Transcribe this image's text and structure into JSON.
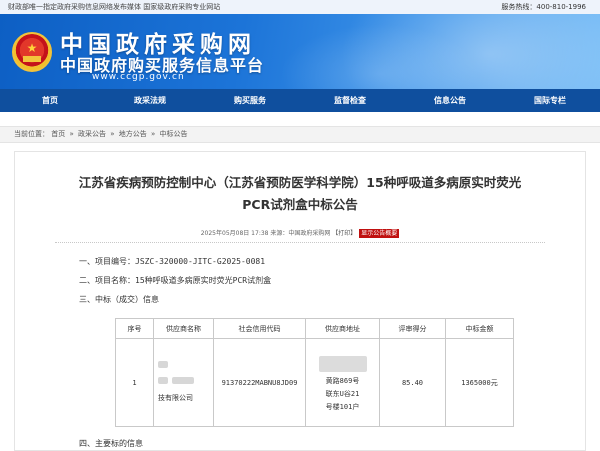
{
  "topbar": {
    "left_text": "财政部唯一指定政府采购信息网络发布媒体  国家级政府采购专业网站",
    "phone_label": "服务热线：400-810-1996"
  },
  "banner": {
    "title": "中国政府采购网",
    "subtitle": "中国政府购买服务信息平台",
    "url": "www.ccgp.gov.cn",
    "emblem_icon": "national-emblem-icon"
  },
  "nav": {
    "items": [
      "首页",
      "政采法规",
      "购买服务",
      "监督检查",
      "信息公告",
      "国际专栏"
    ]
  },
  "breadcrumb": {
    "prefix": "当前位置：",
    "items": [
      "首页",
      "政采公告",
      "地方公告",
      "中标公告"
    ],
    "separator": "»"
  },
  "article": {
    "title_line1": "江苏省疾病预防控制中心（江苏省预防医学科学院）15种呼吸道多病原实时荧光",
    "title_line2": "PCR试剂盒中标公告",
    "meta_text": "2025年05月08日 17:38 来源：中国政府采购网 ",
    "print_label": "【打印】",
    "summary_label": "显示公告概要",
    "items": [
      "一、项目编号：JSZC-320000-JITC-G2025-0081",
      "二、项目名称：15种呼吸道多病原实时荧光PCR试剂盒",
      "三、中标（成交）信息"
    ],
    "next_heading_partial": "四、主要标的信息"
  },
  "table": {
    "headers": [
      "序号",
      "供应商名称",
      "社会信用代码",
      "供应商地址",
      "评审得分",
      "中标金额"
    ],
    "rows": [
      {
        "index": "1",
        "supplier_visible": "技有限公司",
        "credit_code": "91370222MABNU8JD09",
        "address_visible": [
          "黄路869号",
          "联东U谷21",
          "号楼101户"
        ],
        "score": "85.40",
        "amount": "1365000元"
      }
    ]
  },
  "colors": {
    "nav_bg": "#0f4f9e",
    "banner_blue": "#1c74d8",
    "summary_red": "#c0100f"
  }
}
